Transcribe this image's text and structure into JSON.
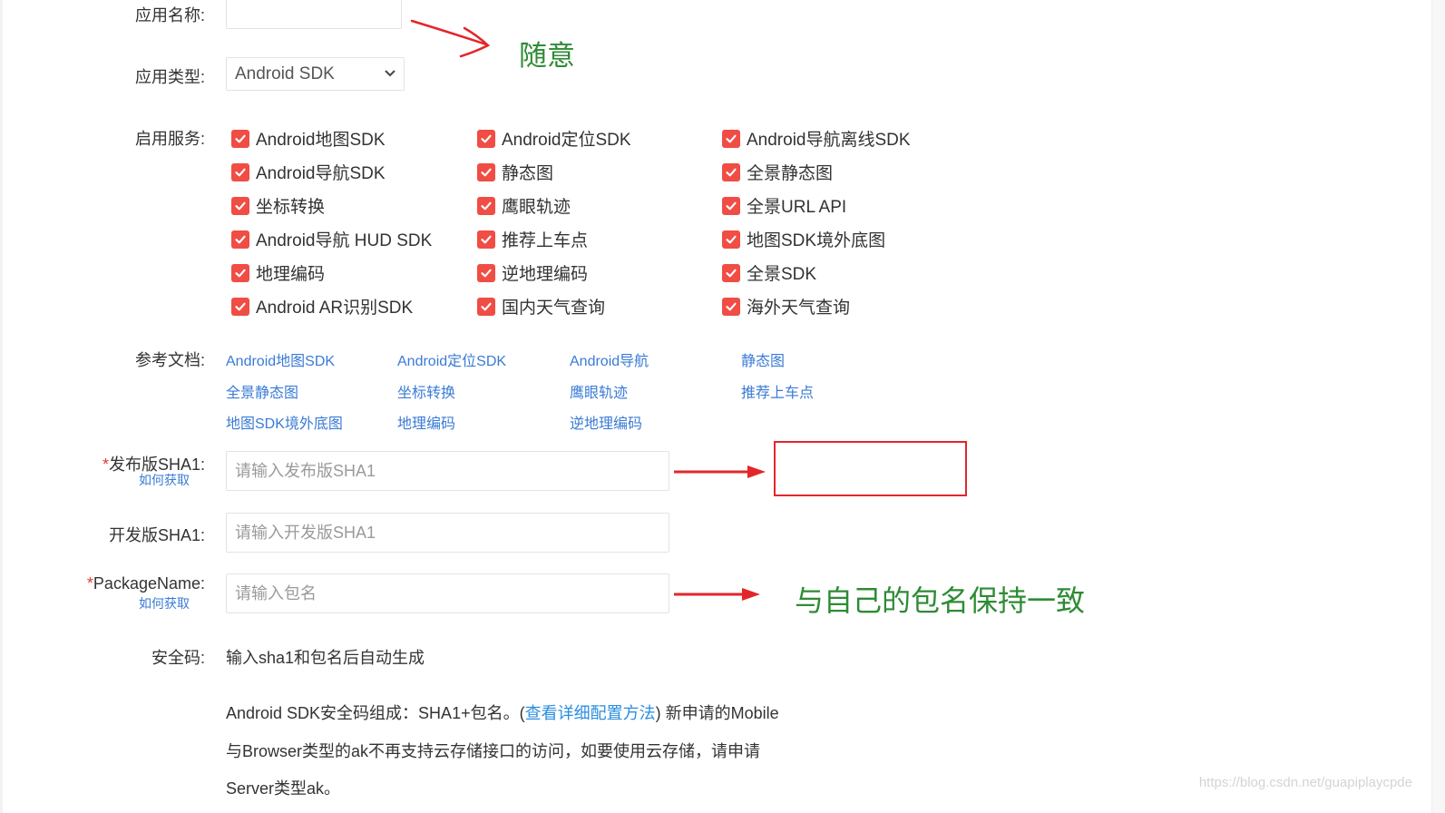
{
  "form": {
    "app_name": {
      "label": "应用名称:",
      "value": ""
    },
    "app_type": {
      "label": "应用类型:",
      "selected": "Android SDK"
    },
    "services": {
      "label": "启用服务:",
      "columns": [
        [
          "Android地图SDK",
          "Android导航SDK",
          "坐标转换",
          "Android导航 HUD SDK",
          "地理编码",
          "Android AR识别SDK"
        ],
        [
          "Android定位SDK",
          "静态图",
          "鹰眼轨迹",
          "推荐上车点",
          "逆地理编码",
          "国内天气查询"
        ],
        [
          "Android导航离线SDK",
          "全景静态图",
          "全景URL API",
          "地图SDK境外底图",
          "全景SDK",
          "海外天气查询"
        ]
      ],
      "checked": true
    },
    "docs": {
      "label": "参考文档:",
      "rows": [
        [
          "Android地图SDK",
          "Android定位SDK",
          "Android导航",
          "静态图"
        ],
        [
          "全景静态图",
          "坐标转换",
          "鹰眼轨迹",
          "推荐上车点"
        ],
        [
          "地图SDK境外底图",
          "地理编码",
          "逆地理编码"
        ]
      ]
    },
    "release_sha1": {
      "required_mark": "*",
      "label": "发布版SHA1:",
      "help": "如何获取",
      "placeholder": "请输入发布版SHA1"
    },
    "dev_sha1": {
      "label": "开发版SHA1:",
      "placeholder": "请输入开发版SHA1"
    },
    "package_name": {
      "required_mark": "*",
      "label": "PackageName:",
      "help": "如何获取",
      "placeholder": "请输入包名"
    },
    "security_code": {
      "label": "安全码:",
      "value": "输入sha1和包名后自动生成"
    },
    "notice": {
      "line1_before": "Android SDK安全码组成：SHA1+包名。(",
      "line1_link": "查看详细配置方法",
      "line1_after": ") 新申请的Mobile",
      "line2": "与Browser类型的ak不再支持云存储接口的访问，如要使用云存储，请申请",
      "line3": "Server类型ak。"
    }
  },
  "annotations": {
    "any_text": "随意",
    "package_text": "与自己的包名保持一致"
  },
  "watermark": "https://blog.csdn.net/guapiplaycpde",
  "colors": {
    "checkbox": "#f04d45",
    "link": "#3a7bd5",
    "annotation_green": "#2e8b34",
    "annotation_red": "#e3262a"
  }
}
